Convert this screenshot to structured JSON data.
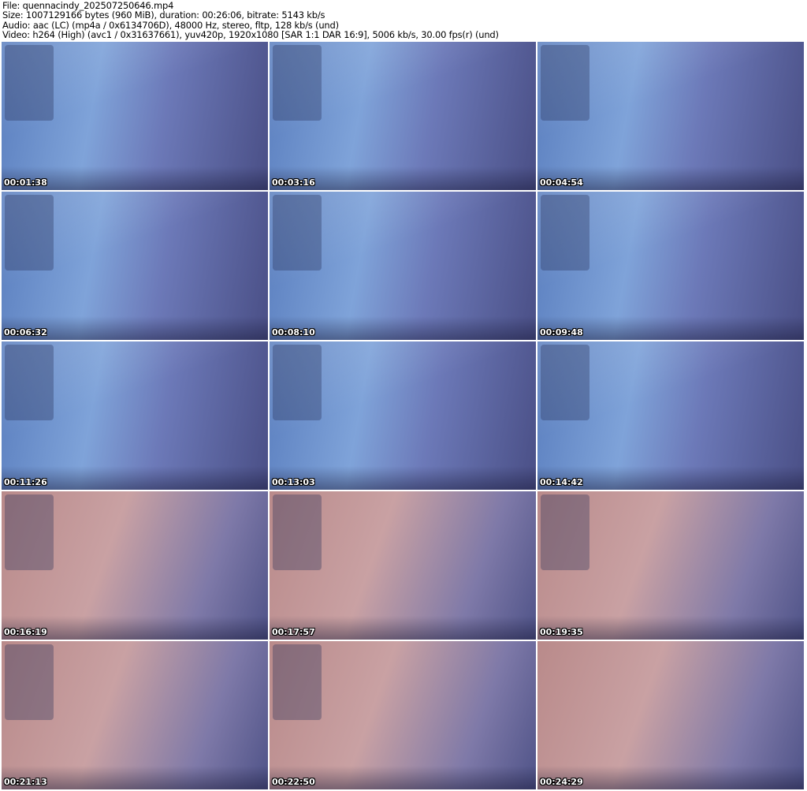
{
  "header": {
    "file": "File: quennacindy_202507250646.mp4",
    "size": "Size: 1007129166 bytes (960 MiB), duration: 00:26:06, bitrate: 5143 kb/s",
    "audio": "Audio: aac (LC) (mp4a / 0x6134706D), 48000 Hz, stereo, fltp, 128 kb/s (und)",
    "video": "Video: h264 (High) (avc1 / 0x31637661), yuv420p, 1920x1080 [SAR 1:1 DAR 16:9], 5006 kb/s, 30.00 fps(r) (und)"
  },
  "thumbnails": [
    {
      "timestamp": "00:01:38"
    },
    {
      "timestamp": "00:03:16"
    },
    {
      "timestamp": "00:04:54"
    },
    {
      "timestamp": "00:06:32"
    },
    {
      "timestamp": "00:08:10"
    },
    {
      "timestamp": "00:09:48"
    },
    {
      "timestamp": "00:11:26"
    },
    {
      "timestamp": "00:13:03"
    },
    {
      "timestamp": "00:14:42"
    },
    {
      "timestamp": "00:16:19"
    },
    {
      "timestamp": "00:17:57"
    },
    {
      "timestamp": "00:19:35"
    },
    {
      "timestamp": "00:21:13"
    },
    {
      "timestamp": "00:22:50"
    },
    {
      "timestamp": "00:24:29"
    }
  ]
}
